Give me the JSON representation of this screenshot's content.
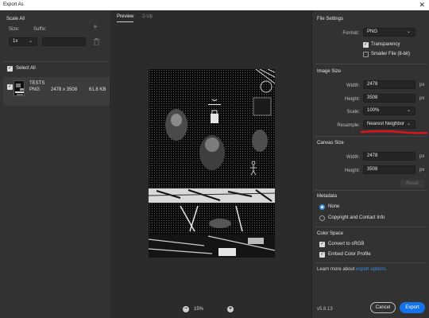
{
  "window": {
    "title": "Export As"
  },
  "left": {
    "scale_all_label": "Scale All",
    "size_label": "Size:",
    "suffix_label": "Suffix:",
    "size_value": "1x",
    "suffix_value": "",
    "select_all_label": "Select All",
    "asset": {
      "name": "TESTS",
      "format": "PNG",
      "dimensions": "2478 x 3508",
      "filesize": "61.8 KB"
    }
  },
  "center": {
    "tabs": [
      {
        "label": "Preview"
      },
      {
        "label": "2-Up"
      }
    ],
    "zoom_value": "15%"
  },
  "right": {
    "file_settings": {
      "heading": "File Settings",
      "format_label": "Format:",
      "format_value": "PNG",
      "transparency_label": "Transparency",
      "transparency_checked": true,
      "smaller_file_label": "Smaller File (8-bit)",
      "smaller_file_checked": false
    },
    "image_size": {
      "heading": "Image Size",
      "width_label": "Width:",
      "width_value": "2478",
      "height_label": "Height:",
      "height_value": "3508",
      "scale_label": "Scale:",
      "scale_value": "100%",
      "resample_label": "Resample:",
      "resample_value": "Nearest Neighbor",
      "unit": "px"
    },
    "canvas_size": {
      "heading": "Canvas Size",
      "width_label": "Width:",
      "width_value": "2478",
      "height_label": "Height:",
      "height_value": "3508",
      "unit": "px",
      "reset_label": "Reset"
    },
    "metadata": {
      "heading": "Metadata",
      "none_label": "None",
      "copyright_label": "Copyright and Contact Info",
      "selected": "None"
    },
    "color_space": {
      "heading": "Color Space",
      "convert_label": "Convert to sRGB",
      "embed_label": "Embed Color Profile"
    },
    "learn_more_text": "Learn more about ",
    "learn_more_link": "export options.",
    "version": "v5.8.13",
    "cancel_label": "Cancel",
    "export_label": "Export"
  },
  "colors": {
    "accent": "#1473e6",
    "annotation": "#e0121b",
    "panel": "#323232",
    "canvas_bg": "#2b2b2b"
  },
  "icons": {
    "plus": "plus-icon",
    "trash": "trash-icon",
    "close": "close-icon",
    "chevron": "chevron-down-icon"
  }
}
